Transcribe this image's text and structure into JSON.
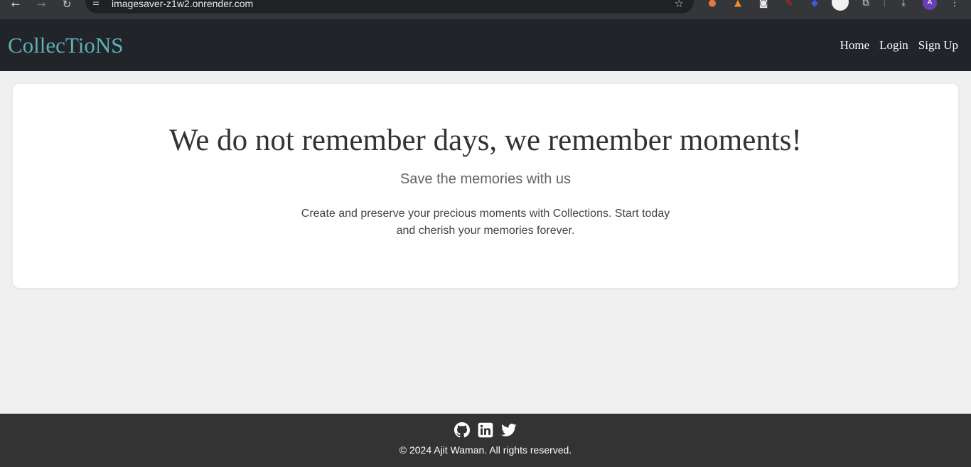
{
  "browser": {
    "url": "imagesaver-z1w2.onrender.com",
    "profile_initial": "A",
    "icons": [
      "back-icon",
      "forward-icon",
      "reload-icon",
      "site-settings-icon",
      "bookmark-star-icon",
      "extensions-icon",
      "downloads-icon",
      "menu-icon"
    ]
  },
  "navbar": {
    "brand": "CollecTioNS",
    "links": [
      "Home",
      "Login",
      "Sign Up"
    ]
  },
  "hero": {
    "title": "We do not remember days, we remember moments!",
    "subtitle": "Save the memories with us",
    "description": "Create and preserve your precious moments with Collections. Start today and cherish your memories forever."
  },
  "footer": {
    "social_icons": [
      "github-icon",
      "linkedin-icon",
      "twitter-icon"
    ],
    "copyright": "© 2024 Ajit Waman. All rights reserved."
  },
  "colors": {
    "navbar_bg": "#212529",
    "brand": "#5fb0b7",
    "page_bg": "#f0f0f0",
    "footer_bg": "#333333"
  }
}
